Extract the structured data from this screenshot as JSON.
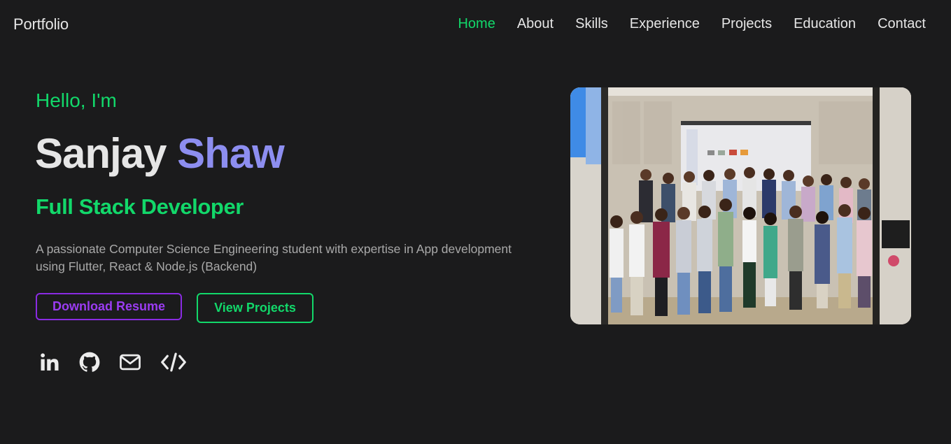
{
  "brand": "Portfolio",
  "nav": {
    "items": [
      {
        "label": "Home",
        "active": true
      },
      {
        "label": "About"
      },
      {
        "label": "Skills"
      },
      {
        "label": "Experience"
      },
      {
        "label": "Projects"
      },
      {
        "label": "Education"
      },
      {
        "label": "Contact"
      }
    ]
  },
  "hero": {
    "greeting": "Hello, I'm",
    "first_name": "Sanjay",
    "last_name": "Shaw",
    "role": "Full Stack Developer",
    "description": "A passionate Computer Science Engineering student with expertise in App development using Flutter, React & Node.js (Backend)",
    "buttons": {
      "resume": "Download Resume",
      "projects": "View Projects"
    },
    "socials": [
      "linkedin-icon",
      "github-icon",
      "mail-icon",
      "code-icon"
    ]
  },
  "colors": {
    "background": "#1b1b1c",
    "accent_green": "#12d86a",
    "accent_purple": "#8d8ef0",
    "resume_border": "#8a2be2"
  }
}
